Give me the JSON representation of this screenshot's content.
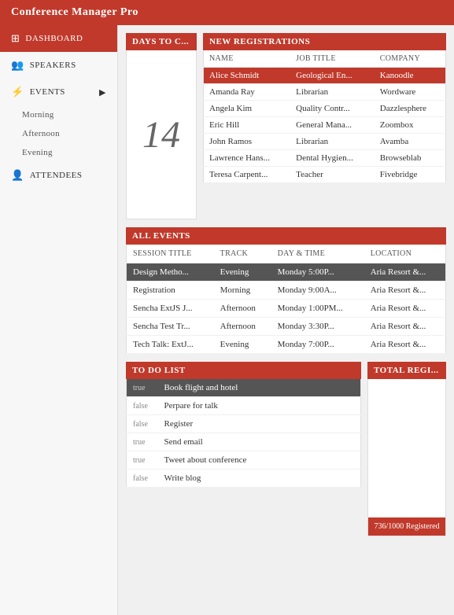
{
  "header": {
    "title": "Conference Manager Pro"
  },
  "sidebar": {
    "items": [
      {
        "id": "dashboard",
        "label": "Dashboard",
        "icon": "⊞",
        "active": true
      },
      {
        "id": "speakers",
        "label": "Speakers",
        "icon": "👥"
      },
      {
        "id": "events",
        "label": "Events",
        "icon": "⚡",
        "hasArrow": true
      },
      {
        "id": "morning",
        "label": "Morning",
        "sub": true
      },
      {
        "id": "afternoon",
        "label": "Afternoon",
        "sub": true
      },
      {
        "id": "evening",
        "label": "Evening",
        "sub": true
      },
      {
        "id": "attendees",
        "label": "Attendees",
        "icon": "👤"
      }
    ]
  },
  "days": {
    "header": "Days To C...",
    "count": "14"
  },
  "registrations": {
    "header": "New Registrations",
    "columns": [
      "Name",
      "Job Title",
      "Company"
    ],
    "rows": [
      {
        "name": "Alice Schmidt",
        "job": "Geological En...",
        "company": "Kanoodle",
        "highlight": true
      },
      {
        "name": "Amanda Ray",
        "job": "Librarian",
        "company": "Wordware"
      },
      {
        "name": "Angela Kim",
        "job": "Quality Contr...",
        "company": "Dazzlesphere"
      },
      {
        "name": "Eric Hill",
        "job": "General Mana...",
        "company": "Zoombox"
      },
      {
        "name": "John Ramos",
        "job": "Librarian",
        "company": "Avamba"
      },
      {
        "name": "Lawrence Hans...",
        "job": "Dental Hygien...",
        "company": "Browseblab"
      },
      {
        "name": "Teresa Carpent...",
        "job": "Teacher",
        "company": "Fivebridge"
      }
    ]
  },
  "events": {
    "header": "All Events",
    "columns": [
      "Session Title",
      "Track",
      "Day & Time",
      "Location"
    ],
    "rows": [
      {
        "title": "Design Metho...",
        "track": "Evening",
        "time": "Monday 5:00P...",
        "location": "Aria Resort &...",
        "highlight": true
      },
      {
        "title": "Registration",
        "track": "Morning",
        "time": "Monday 9:00A...",
        "location": "Aria Resort &..."
      },
      {
        "title": "Sencha ExtJS J...",
        "track": "Afternoon",
        "time": "Monday 1:00PM...",
        "location": "Aria Resort &..."
      },
      {
        "title": "Sencha Test Tr...",
        "track": "Afternoon",
        "time": "Monday 3:30P...",
        "location": "Aria Resort &..."
      },
      {
        "title": "Tech Talk: ExtJ...",
        "track": "Evening",
        "time": "Monday 7:00P...",
        "location": "Aria Resort &..."
      }
    ]
  },
  "todo": {
    "header": "To Do List",
    "rows": [
      {
        "done": "true",
        "task": "Book flight and hotel",
        "highlight": true
      },
      {
        "done": "false",
        "task": "Perpare for talk"
      },
      {
        "done": "false",
        "task": "Register"
      },
      {
        "done": "true",
        "task": "Send email"
      },
      {
        "done": "true",
        "task": "Tweet about conference"
      },
      {
        "done": "false",
        "task": "Write blog"
      }
    ]
  },
  "total": {
    "header": "Total Regi...",
    "bar_text": "736/1000 Registered"
  }
}
